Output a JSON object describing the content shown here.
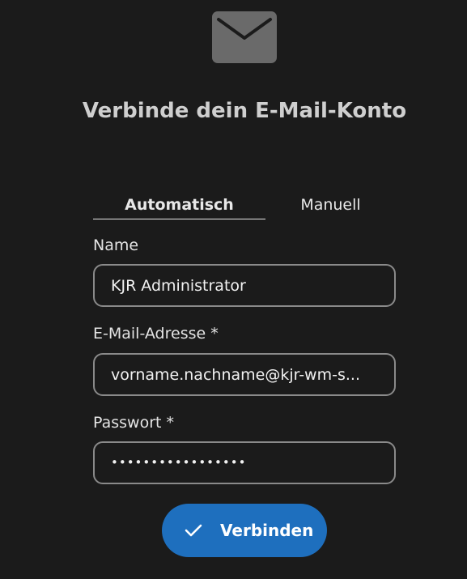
{
  "header": {
    "icon": "mail-icon",
    "title": "Verbinde dein E-Mail-Konto"
  },
  "tabs": [
    {
      "label": "Automatisch",
      "selected": true
    },
    {
      "label": "Manuell",
      "selected": false
    }
  ],
  "form": {
    "name": {
      "label": "Name",
      "value": "KJR Administrator"
    },
    "email": {
      "label": "E-Mail-Adresse *",
      "value": "vorname.nachname@kjr-wm-s..."
    },
    "password": {
      "label": "Passwort *",
      "masked_value": "•••••••••••••••••"
    }
  },
  "actions": {
    "connect_icon": "checkmark-icon",
    "connect_label": "Verbinden"
  },
  "colors": {
    "background": "#1b1b1b",
    "icon_fill": "#6a6a6a",
    "field_border": "#8a8a8a",
    "accent": "#1e6fbe",
    "text": "#e6e6e6"
  }
}
